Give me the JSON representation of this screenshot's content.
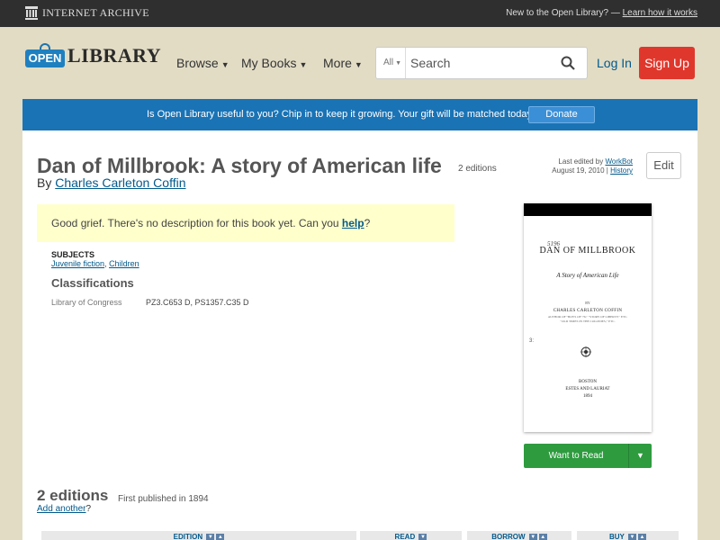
{
  "ia_bar": {
    "logo_text": "Internet Archive",
    "new_text": "New to the Open Library? —",
    "learn_link": "Learn how it works"
  },
  "header": {
    "logo_open": "OPEN",
    "logo_library": "LIBRARY",
    "nav": [
      {
        "label": "Browse"
      },
      {
        "label": "My Books"
      },
      {
        "label": "More"
      }
    ],
    "search_scope": "All",
    "search_placeholder": "Search",
    "login": "Log In",
    "signup": "Sign Up"
  },
  "banner": {
    "text": "Is Open Library useful to you? Chip in to keep it growing. Your gift will be matched today!",
    "donate": "Donate"
  },
  "work": {
    "title": "Dan of Millbrook: A story of American life",
    "edition_count": "2 editions",
    "by": "By",
    "author": "Charles Carleton Coffin",
    "last_edited_label": "Last edited by",
    "last_edited_user": "WorkBot",
    "last_edited_date": "August 19, 2010",
    "history": "History",
    "edit": "Edit",
    "no_description": "Good grief. There's no description for this book yet. Can you",
    "help_link": "help",
    "help_suffix": "?",
    "subjects_label": "SUBJECTS",
    "subjects": [
      "Juvenile fiction",
      "Children"
    ],
    "classifications_label": "Classifications",
    "classification_scheme": "Library of Congress",
    "classification_value": "PZ3.C653 D, PS1357.C35 D"
  },
  "cover": {
    "number": "5196",
    "title": "DAN OF MILLBROOK",
    "subtitle": "A Story of American Life",
    "by": "BY",
    "author": "CHARLES CARLETON COFFIN",
    "line1": "AUTHOR OF \"BOYS OF '76,\" \"STORY OF LIBERTY,\" ETC.",
    "line2": "\"OLD TIMES IN THE COLONIES,\" ETC.",
    "mark": "3:",
    "place": "BOSTON",
    "publisher": "ESTES AND LAURIAT",
    "year": "1894"
  },
  "want_to_read": "Want to Read",
  "editions": {
    "heading": "2 editions",
    "first_published": "First published in 1894",
    "add_another": "Add another",
    "add_suffix": "?",
    "columns": [
      "EDITION",
      "READ",
      "BORROW",
      "BUY"
    ]
  },
  "colors": {
    "ia_bar": "#2f2f2f",
    "page_bg": "#e2dcc5",
    "banner": "#1a73b5",
    "signup": "#e0372c",
    "want_to_read": "#2e9b3f",
    "link": "#02598b"
  }
}
